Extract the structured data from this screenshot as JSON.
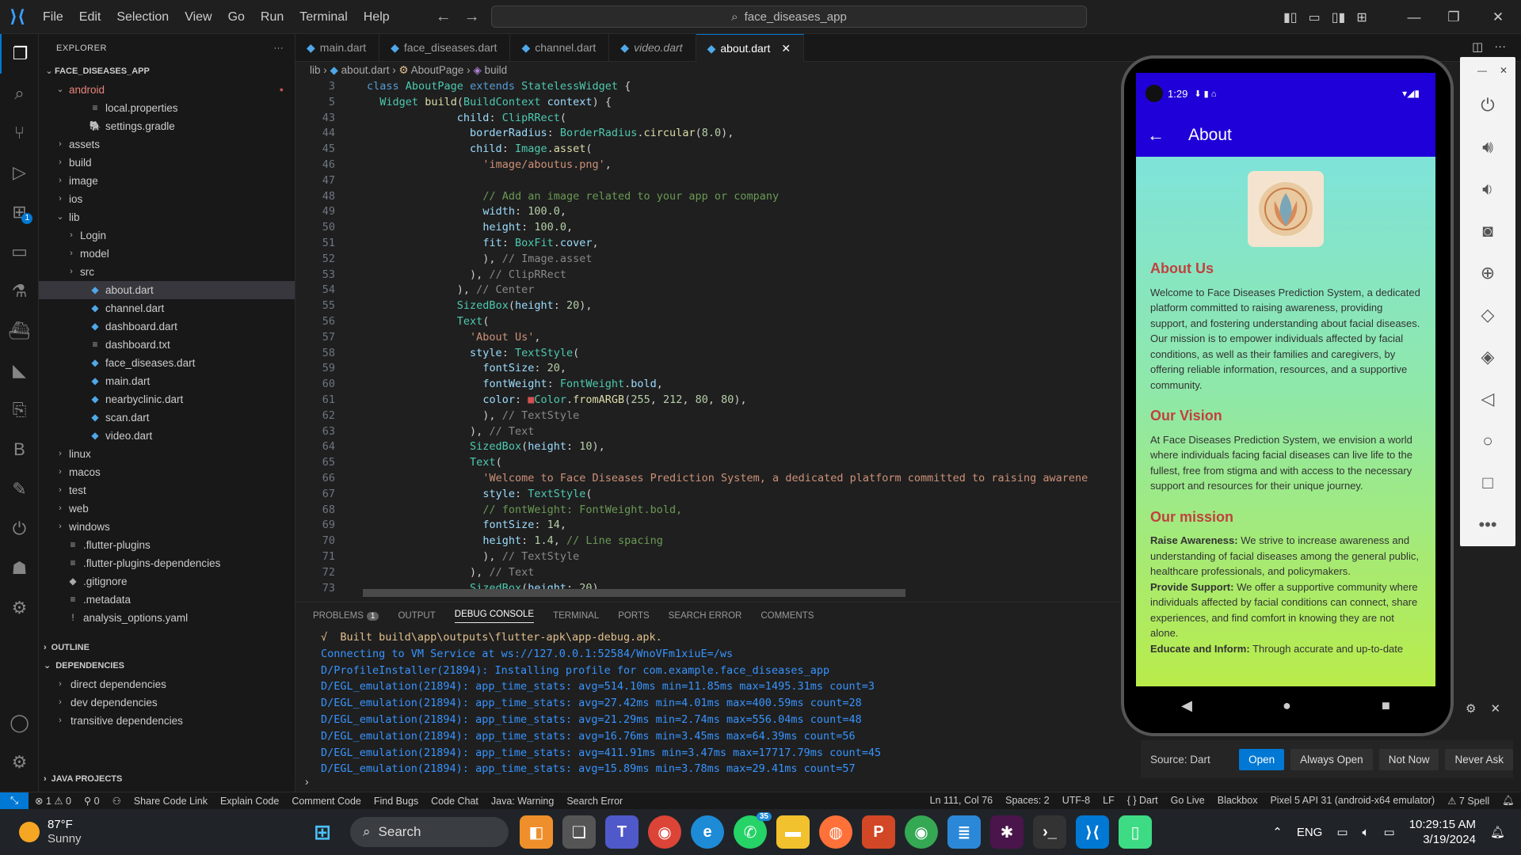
{
  "menu": {
    "items": [
      "File",
      "Edit",
      "Selection",
      "View",
      "Go",
      "Run",
      "Terminal",
      "Help"
    ]
  },
  "command_center": {
    "text": "face_diseases_app"
  },
  "explorer": {
    "title": "EXPLORER",
    "root": "FACE_DISEASES_APP",
    "rows": [
      {
        "label": "android",
        "chev": "⌄",
        "icon": "",
        "indent": 1,
        "color": "#e8857a"
      },
      {
        "label": "local.properties",
        "chev": "",
        "icon": "≡",
        "indent": 3
      },
      {
        "label": "settings.gradle",
        "chev": "",
        "icon": "🐘",
        "indent": 3
      },
      {
        "label": "assets",
        "chev": "›",
        "icon": "",
        "indent": 1
      },
      {
        "label": "build",
        "chev": "›",
        "icon": "",
        "indent": 1
      },
      {
        "label": "image",
        "chev": "›",
        "icon": "",
        "indent": 1
      },
      {
        "label": "ios",
        "chev": "›",
        "icon": "",
        "indent": 1
      },
      {
        "label": "lib",
        "chev": "⌄",
        "icon": "",
        "indent": 1
      },
      {
        "label": "Login",
        "chev": "›",
        "icon": "",
        "indent": 2
      },
      {
        "label": "model",
        "chev": "›",
        "icon": "",
        "indent": 2
      },
      {
        "label": "src",
        "chev": "›",
        "icon": "",
        "indent": 2
      },
      {
        "label": "about.dart",
        "chev": "",
        "icon": "dart",
        "indent": 3,
        "selected": true
      },
      {
        "label": "channel.dart",
        "chev": "",
        "icon": "dart",
        "indent": 3
      },
      {
        "label": "dashboard.dart",
        "chev": "",
        "icon": "dart",
        "indent": 3
      },
      {
        "label": "dashboard.txt",
        "chev": "",
        "icon": "≡",
        "indent": 3
      },
      {
        "label": "face_diseases.dart",
        "chev": "",
        "icon": "dart",
        "indent": 3
      },
      {
        "label": "main.dart",
        "chev": "",
        "icon": "dart",
        "indent": 3
      },
      {
        "label": "nearbyclinic.dart",
        "chev": "",
        "icon": "dart",
        "indent": 3
      },
      {
        "label": "scan.dart",
        "chev": "",
        "icon": "dart",
        "indent": 3
      },
      {
        "label": "video.dart",
        "chev": "",
        "icon": "dart",
        "indent": 3
      },
      {
        "label": "linux",
        "chev": "›",
        "icon": "",
        "indent": 1
      },
      {
        "label": "macos",
        "chev": "›",
        "icon": "",
        "indent": 1
      },
      {
        "label": "test",
        "chev": "›",
        "icon": "",
        "indent": 1
      },
      {
        "label": "web",
        "chev": "›",
        "icon": "",
        "indent": 1
      },
      {
        "label": "windows",
        "chev": "›",
        "icon": "",
        "indent": 1
      },
      {
        "label": ".flutter-plugins",
        "chev": "",
        "icon": "≡",
        "indent": 1
      },
      {
        "label": ".flutter-plugins-dependencies",
        "chev": "",
        "icon": "≡",
        "indent": 1
      },
      {
        "label": ".gitignore",
        "chev": "",
        "icon": "◆",
        "indent": 1
      },
      {
        "label": ".metadata",
        "chev": "",
        "icon": "≡",
        "indent": 1
      },
      {
        "label": "analysis_options.yaml",
        "chev": "",
        "icon": "!",
        "indent": 1
      }
    ],
    "outline": "OUTLINE",
    "dependencies": "DEPENDENCIES",
    "dep_rows": [
      "direct dependencies",
      "dev dependencies",
      "transitive dependencies"
    ],
    "java_projects": "JAVA PROJECTS"
  },
  "tabs": [
    {
      "label": "main.dart",
      "italic": false,
      "active": false
    },
    {
      "label": "face_diseases.dart",
      "italic": false,
      "active": false
    },
    {
      "label": "channel.dart",
      "italic": false,
      "active": false
    },
    {
      "label": "video.dart",
      "italic": true,
      "active": false
    },
    {
      "label": "about.dart",
      "italic": false,
      "active": true
    }
  ],
  "breadcrumb": {
    "lib": "lib",
    "file": "about.dart",
    "cls": "AboutPage",
    "method": "build"
  },
  "code": [
    {
      "n": "3",
      "html": "<span class='kw'>class</span> <span class='cls'>AboutPage</span> <span class='kw'>extends</span> <span class='cls'>StatelessWidget</span> <span class='pun'>{</span>",
      "indent": 0
    },
    {
      "n": "5",
      "html": "  <span class='cls'>Widget</span> <span class='fn'>build</span>(<span class='cls'>BuildContext</span> <span class='prop'>context</span>) {",
      "indent": 0
    },
    {
      "n": "43",
      "html": "              <span class='prop'>child</span>: <span class='cls'>ClipRRect</span>(",
      "indent": 0
    },
    {
      "n": "44",
      "html": "                <span class='prop'>borderRadius</span>: <span class='cls'>BorderRadius</span>.<span class='fn'>circular</span>(<span class='num'>8.0</span>),",
      "indent": 0
    },
    {
      "n": "45",
      "html": "                <span class='prop'>child</span>: <span class='cls'>Image</span>.<span class='fn'>asset</span>(",
      "indent": 0
    },
    {
      "n": "46",
      "html": "                  <span class='str'>'image/aboutus.png'</span>,",
      "indent": 0
    },
    {
      "n": "47",
      "html": "",
      "indent": 0
    },
    {
      "n": "48",
      "html": "                  <span class='cm'>// Add an image related to your app or company</span>",
      "indent": 0
    },
    {
      "n": "49",
      "html": "                  <span class='prop'>width</span>: <span class='num'>100.0</span>,",
      "indent": 0
    },
    {
      "n": "50",
      "html": "                  <span class='prop'>height</span>: <span class='num'>100.0</span>,",
      "indent": 0
    },
    {
      "n": "51",
      "html": "                  <span class='prop'>fit</span>: <span class='cls'>BoxFit</span>.<span class='prop'>cover</span>,",
      "indent": 0
    },
    {
      "n": "52",
      "html": "                  ), <span class='gr'>// Image.asset</span>",
      "indent": 0
    },
    {
      "n": "53",
      "html": "                ), <span class='gr'>// ClipRRect</span>",
      "indent": 0
    },
    {
      "n": "54",
      "html": "              ), <span class='gr'>// Center</span>",
      "indent": 0
    },
    {
      "n": "55",
      "html": "              <span class='cls'>SizedBox</span>(<span class='prop'>height</span>: <span class='num'>20</span>),",
      "indent": 0
    },
    {
      "n": "56",
      "html": "              <span class='cls'>Text</span>(",
      "indent": 0
    },
    {
      "n": "57",
      "html": "                <span class='str'>'About Us'</span>,",
      "indent": 0
    },
    {
      "n": "58",
      "html": "                <span class='prop'>style</span>: <span class='cls'>TextStyle</span>(",
      "indent": 0
    },
    {
      "n": "59",
      "html": "                  <span class='prop'>fontSize</span>: <span class='num'>20</span>,",
      "indent": 0
    },
    {
      "n": "60",
      "html": "                  <span class='prop'>fontWeight</span>: <span class='cls'>FontWeight</span>.<span class='prop'>bold</span>,",
      "indent": 0
    },
    {
      "n": "61",
      "html": "                  <span class='prop'>color</span>: <span style='color:#d45050'>■</span><span class='cls'>Color</span>.<span class='fn'>fromARGB</span>(<span class='num'>255</span>, <span class='num'>212</span>, <span class='num'>80</span>, <span class='num'>80</span>),",
      "indent": 0
    },
    {
      "n": "62",
      "html": "                  ), <span class='gr'>// TextStyle</span>",
      "indent": 0
    },
    {
      "n": "63",
      "html": "                ), <span class='gr'>// Text</span>",
      "indent": 0
    },
    {
      "n": "64",
      "html": "                <span class='cls'>SizedBox</span>(<span class='prop'>height</span>: <span class='num'>10</span>),",
      "indent": 0
    },
    {
      "n": "65",
      "html": "                <span class='cls'>Text</span>(",
      "indent": 0
    },
    {
      "n": "66",
      "html": "                  <span class='str'>'Welcome to Face Diseases Prediction System, a dedicated platform committed to raising awarene</span>",
      "indent": 0
    },
    {
      "n": "67",
      "html": "                  <span class='prop'>style</span>: <span class='cls'>TextStyle</span>(",
      "indent": 0
    },
    {
      "n": "68",
      "html": "                  <span class='cm'>// fontWeight: FontWeight.bold,</span>",
      "indent": 0
    },
    {
      "n": "69",
      "html": "                  <span class='prop'>fontSize</span>: <span class='num'>14</span>,",
      "indent": 0
    },
    {
      "n": "70",
      "html": "                  <span class='prop'>height</span>: <span class='num'>1.4</span>, <span class='cm'>// Line spacing</span>",
      "indent": 0
    },
    {
      "n": "71",
      "html": "                  ), <span class='gr'>// TextStyle</span>",
      "indent": 0
    },
    {
      "n": "72",
      "html": "                ), <span class='gr'>// Text</span>",
      "indent": 0
    },
    {
      "n": "73",
      "html": "                <span class='cls'>SizedBox</span>(<span class='prop'>height</span>: <span class='num'>20</span>),",
      "indent": 0
    }
  ],
  "panel": {
    "tabs": [
      "PROBLEMS",
      "OUTPUT",
      "DEBUG CONSOLE",
      "TERMINAL",
      "PORTS",
      "SEARCH ERROR",
      "COMMENTS"
    ],
    "problems_count": "1",
    "active_tab": "DEBUG CONSOLE",
    "lines": [
      "√  Built build\\app\\outputs\\flutter-apk\\app-debug.apk.",
      "Connecting to VM Service at ws://127.0.0.1:52584/WnoVFm1xiuE=/ws",
      "D/ProfileInstaller(21894): Installing profile for com.example.face_diseases_app",
      "D/EGL_emulation(21894): app_time_stats: avg=514.10ms min=11.85ms max=1495.31ms count=3",
      "D/EGL_emulation(21894): app_time_stats: avg=27.42ms min=4.01ms max=400.59ms count=28",
      "D/EGL_emulation(21894): app_time_stats: avg=21.29ms min=2.74ms max=556.04ms count=48",
      "D/EGL_emulation(21894): app_time_stats: avg=16.76ms min=3.45ms max=64.39ms count=56",
      "D/EGL_emulation(21894): app_time_stats: avg=411.91ms min=3.47ms max=17717.79ms count=45",
      "D/EGL_emulation(21894): app_time_stats: avg=15.89ms min=3.78ms max=29.41ms count=57"
    ]
  },
  "status": {
    "errors": "⊗ 1 ⚠ 0",
    "ports": "⚲ 0",
    "items": [
      "Share Code Link",
      "Explain Code",
      "Comment Code",
      "Find Bugs",
      "Code Chat",
      "Java: Warning",
      "Search Error"
    ],
    "right": [
      "Ln 111, Col 76",
      "Spaces: 2",
      "UTF-8",
      "LF",
      "{ } Dart",
      "Go Live",
      "Blackbox",
      "Pixel 5 API 31 (android-x64 emulator)",
      "⚠ 7 Spell"
    ]
  },
  "phone": {
    "time": "1:29",
    "title": "About",
    "about_heading": "About Us",
    "about_text": "Welcome to Face Diseases Prediction System, a dedicated platform committed to raising awareness, providing support, and fostering understanding about facial diseases. Our mission is to empower individuals affected by facial conditions, as well as their families and caregivers, by offering reliable information, resources, and a supportive community.",
    "vision_heading": "Our Vision",
    "vision_text": "At Face Diseases Prediction System, we envision a world where individuals facing facial diseases can live life to the fullest, free from stigma and with access to the necessary support and resources for their unique journey.",
    "mission_heading": "Our mission",
    "m1_b": "Raise Awareness:",
    "m1": " We strive to increase awareness and understanding of facial diseases among the general public, healthcare professionals, and policymakers.",
    "m2_b": "Provide Support:",
    "m2": " We offer a supportive community where individuals affected by facial conditions can connect, share experiences, and find comfort in knowing they are not alone.",
    "m3_b": "Educate and Inform:",
    "m3": " Through accurate and up-to-date"
  },
  "popup": {
    "source": "Source: Dart",
    "open": "Open",
    "always": "Always Open",
    "not_now": "Not Now",
    "never": "Never Ask"
  },
  "taskbar": {
    "temp": "87°F",
    "weather": "Sunny",
    "search": "Search",
    "lang": "ENG",
    "time": "10:29:15 AM",
    "date": "3/19/2024",
    "whatsapp_badge": "35"
  }
}
